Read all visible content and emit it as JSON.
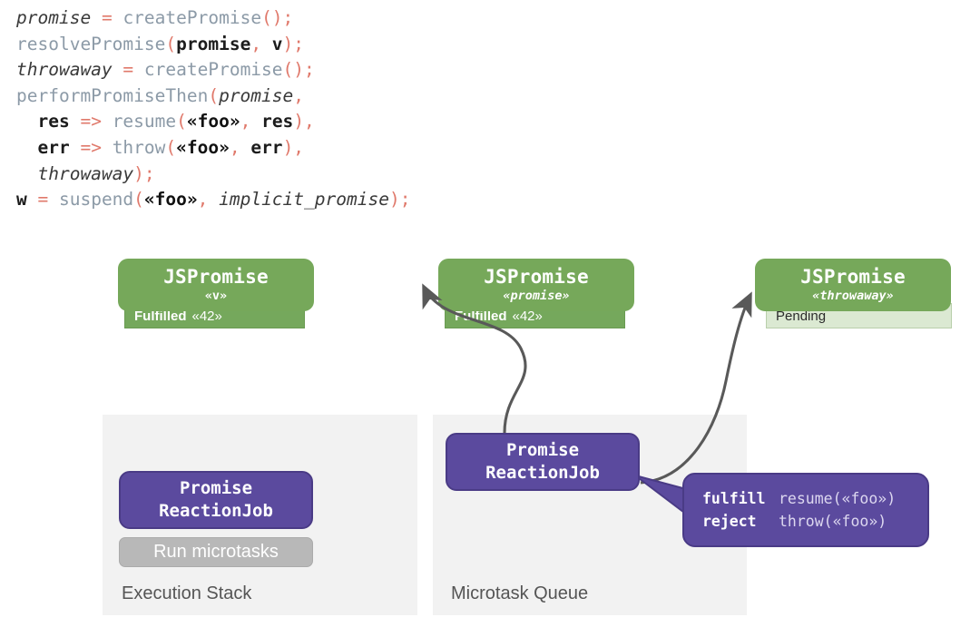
{
  "code": {
    "lines": [
      [
        {
          "t": "promise",
          "c": "id"
        },
        {
          "t": " ",
          "c": "pn"
        },
        {
          "t": "=",
          "c": "pn"
        },
        {
          "t": " ",
          "c": "pn"
        },
        {
          "t": "createPromise",
          "c": "fn"
        },
        {
          "t": "();",
          "c": "pn"
        }
      ],
      [
        {
          "t": "resolvePromise",
          "c": "fn"
        },
        {
          "t": "(",
          "c": "pn"
        },
        {
          "t": "promise",
          "c": "vr"
        },
        {
          "t": ", ",
          "c": "pn"
        },
        {
          "t": "v",
          "c": "vr"
        },
        {
          "t": ");",
          "c": "pn"
        }
      ],
      [
        {
          "t": "throwaway",
          "c": "id"
        },
        {
          "t": " = ",
          "c": "pn"
        },
        {
          "t": "createPromise",
          "c": "fn"
        },
        {
          "t": "();",
          "c": "pn"
        }
      ],
      [
        {
          "t": "performPromiseThen",
          "c": "fn"
        },
        {
          "t": "(",
          "c": "pn"
        },
        {
          "t": "promise",
          "c": "id"
        },
        {
          "t": ",",
          "c": "pn"
        }
      ],
      [
        {
          "t": "  ",
          "c": "pn"
        },
        {
          "t": "res",
          "c": "vr"
        },
        {
          "t": " => ",
          "c": "pn"
        },
        {
          "t": "resume",
          "c": "fn"
        },
        {
          "t": "(",
          "c": "pn"
        },
        {
          "t": "«foo»",
          "c": "lit"
        },
        {
          "t": ", ",
          "c": "pn"
        },
        {
          "t": "res",
          "c": "vr"
        },
        {
          "t": "),",
          "c": "pn"
        }
      ],
      [
        {
          "t": "  ",
          "c": "pn"
        },
        {
          "t": "err",
          "c": "vr"
        },
        {
          "t": " => ",
          "c": "pn"
        },
        {
          "t": "throw",
          "c": "fn"
        },
        {
          "t": "(",
          "c": "pn"
        },
        {
          "t": "«foo»",
          "c": "lit"
        },
        {
          "t": ", ",
          "c": "pn"
        },
        {
          "t": "err",
          "c": "vr"
        },
        {
          "t": "),",
          "c": "pn"
        }
      ],
      [
        {
          "t": "  ",
          "c": "pn"
        },
        {
          "t": "throwaway",
          "c": "id"
        },
        {
          "t": ");",
          "c": "pn"
        }
      ],
      [
        {
          "t": "w",
          "c": "vr"
        },
        {
          "t": " = ",
          "c": "pn"
        },
        {
          "t": "suspend",
          "c": "fn"
        },
        {
          "t": "(",
          "c": "pn"
        },
        {
          "t": "«foo»",
          "c": "lit"
        },
        {
          "t": ", ",
          "c": "pn"
        },
        {
          "t": "implicit_promise",
          "c": "id"
        },
        {
          "t": ");",
          "c": "pn"
        }
      ]
    ],
    "raw_text": "promise = createPromise();\nresolvePromise(promise, v);\nthrowaway = createPromise();\nperformPromiseThen(promise,\n  res => resume(«foo», res),\n  err => throw(«foo», err),\n  throwaway);\nw = suspend(«foo», implicit_promise);"
  },
  "promises": [
    {
      "title": "JSPromise",
      "subtitle": "«v»",
      "subtitle_italic": false,
      "state_label": "Fulfilled",
      "state_value": "«42»",
      "state_kind": "fulfilled"
    },
    {
      "title": "JSPromise",
      "subtitle": "«promise»",
      "subtitle_italic": true,
      "state_label": "Fulfilled",
      "state_value": "«42»",
      "state_kind": "fulfilled"
    },
    {
      "title": "JSPromise",
      "subtitle": "«throwaway»",
      "subtitle_italic": true,
      "state_label": "Pending",
      "state_value": "",
      "state_kind": "pending"
    }
  ],
  "panels": [
    {
      "label": "Execution Stack"
    },
    {
      "label": "Microtask Queue"
    }
  ],
  "jobs": [
    {
      "line1": "Promise",
      "line2": "ReactionJob"
    },
    {
      "line1": "Promise",
      "line2": "ReactionJob"
    }
  ],
  "run_pill": {
    "label": "Run microtasks"
  },
  "callout": {
    "rows": [
      {
        "key": "fulfill",
        "value": "resume(«foo»)"
      },
      {
        "key": "reject",
        "value": "throw(«foo»)"
      }
    ]
  },
  "colors": {
    "green_header": "#76a85a",
    "green_state": "#75a85c",
    "green_pending": "#dbe9d2",
    "purple": "#5b4a9e",
    "purple_border": "#4a3b86",
    "gray_panel": "#f2f2f2",
    "gray_pill": "#b8b8b8",
    "arrow": "#595959",
    "code_fn": "#8c9aa7",
    "code_punct": "#e0796b"
  }
}
